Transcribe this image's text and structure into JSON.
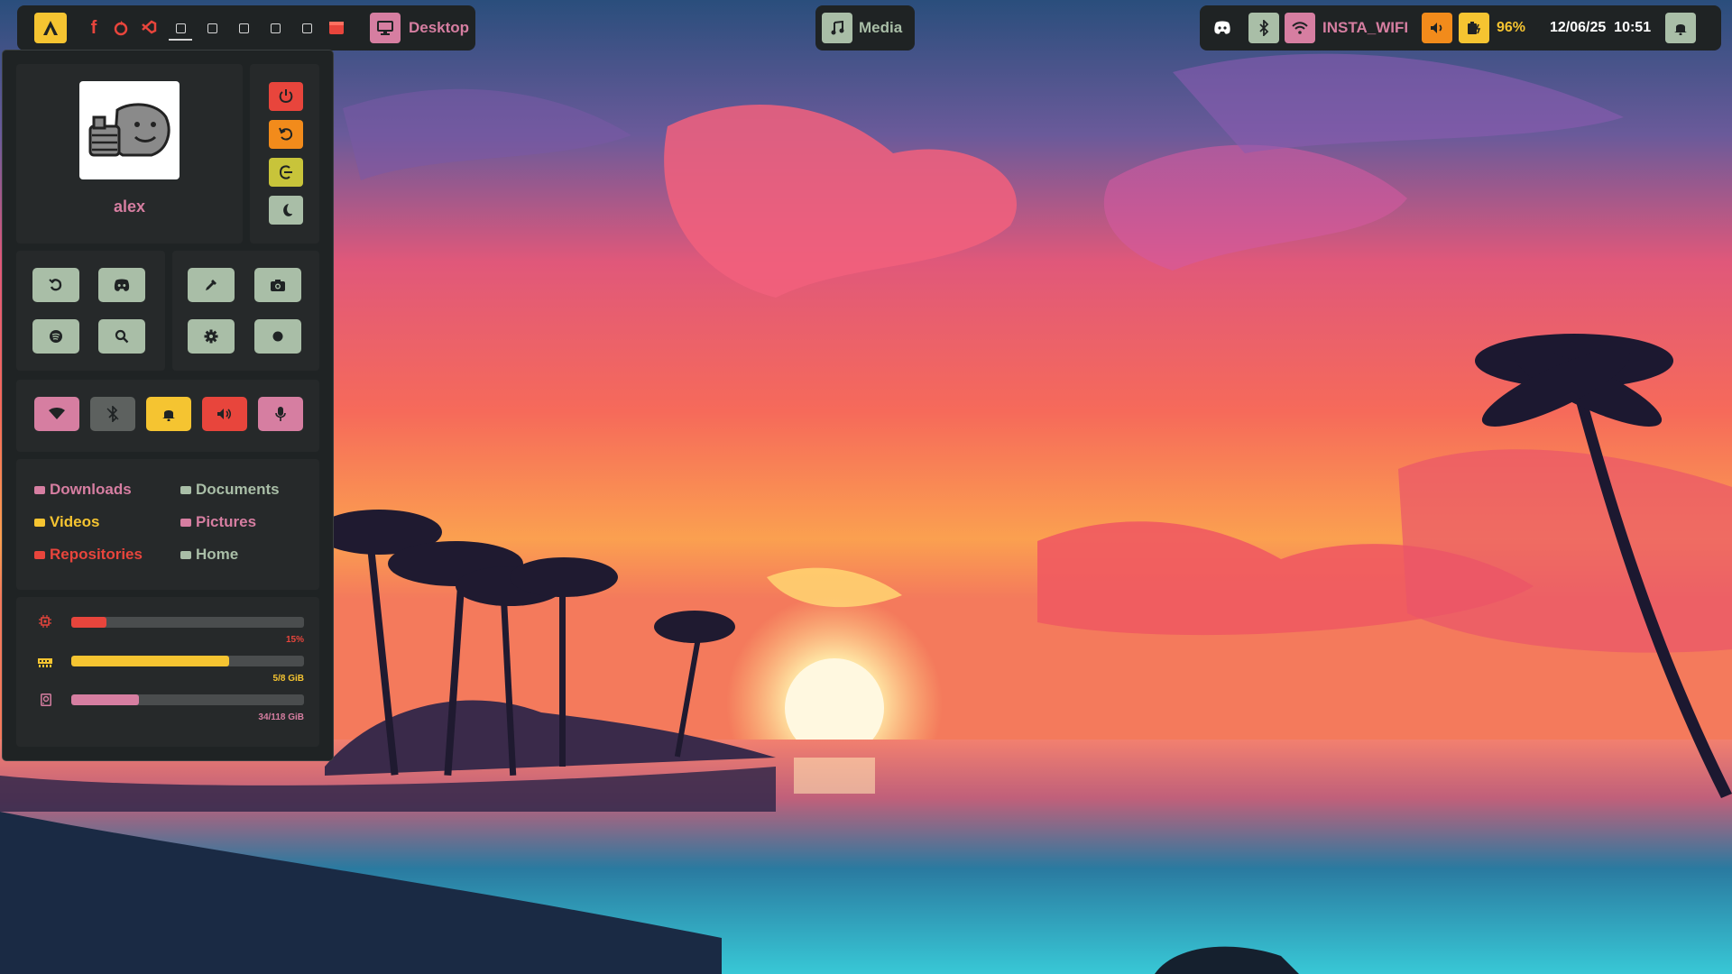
{
  "colors": {
    "accent_yellow": "#f5c431",
    "accent_red": "#e8453c",
    "accent_orange": "#f28b1b",
    "accent_pink": "#d67ea1",
    "accent_green": "#a9bea7",
    "bar_bg": "#1f2324"
  },
  "topbar": {
    "workspace_label": "Desktop",
    "media_label": "Media",
    "wifi_name": "INSTA_WIFI",
    "battery_percent": "96%",
    "datetime": "12/06/25  10:51",
    "apps": [
      "firefox-icon",
      "brave-icon",
      "vscode-icon"
    ],
    "workspaces_count": 6,
    "active_workspace": 1
  },
  "panel": {
    "user": {
      "name": "alex"
    },
    "power_buttons": [
      "power-icon",
      "restart-icon",
      "logout-icon",
      "sleep-icon"
    ],
    "launchers_left": [
      "update-icon",
      "discord-icon",
      "spotify-icon",
      "search-icon"
    ],
    "launchers_right": [
      "color-picker-icon",
      "screenshot-icon",
      "settings-icon",
      "record-icon"
    ],
    "toggles": [
      "wifi-icon",
      "bluetooth-icon",
      "notifications-icon",
      "volume-icon",
      "microphone-icon"
    ],
    "folders": [
      {
        "label": "Downloads",
        "color": "#d67ea1"
      },
      {
        "label": "Documents",
        "color": "#a9bea7"
      },
      {
        "label": "Videos",
        "color": "#f5c431"
      },
      {
        "label": "Pictures",
        "color": "#d67ea1"
      },
      {
        "label": "Repositories",
        "color": "#e8453c"
      },
      {
        "label": "Home",
        "color": "#a9bea7"
      }
    ],
    "stats": {
      "cpu": {
        "text": "15%",
        "value": 0.15
      },
      "ram": {
        "text": "5/8 GiB",
        "value": 0.68
      },
      "disk": {
        "text": "34/118 GiB",
        "value": 0.29
      }
    }
  }
}
